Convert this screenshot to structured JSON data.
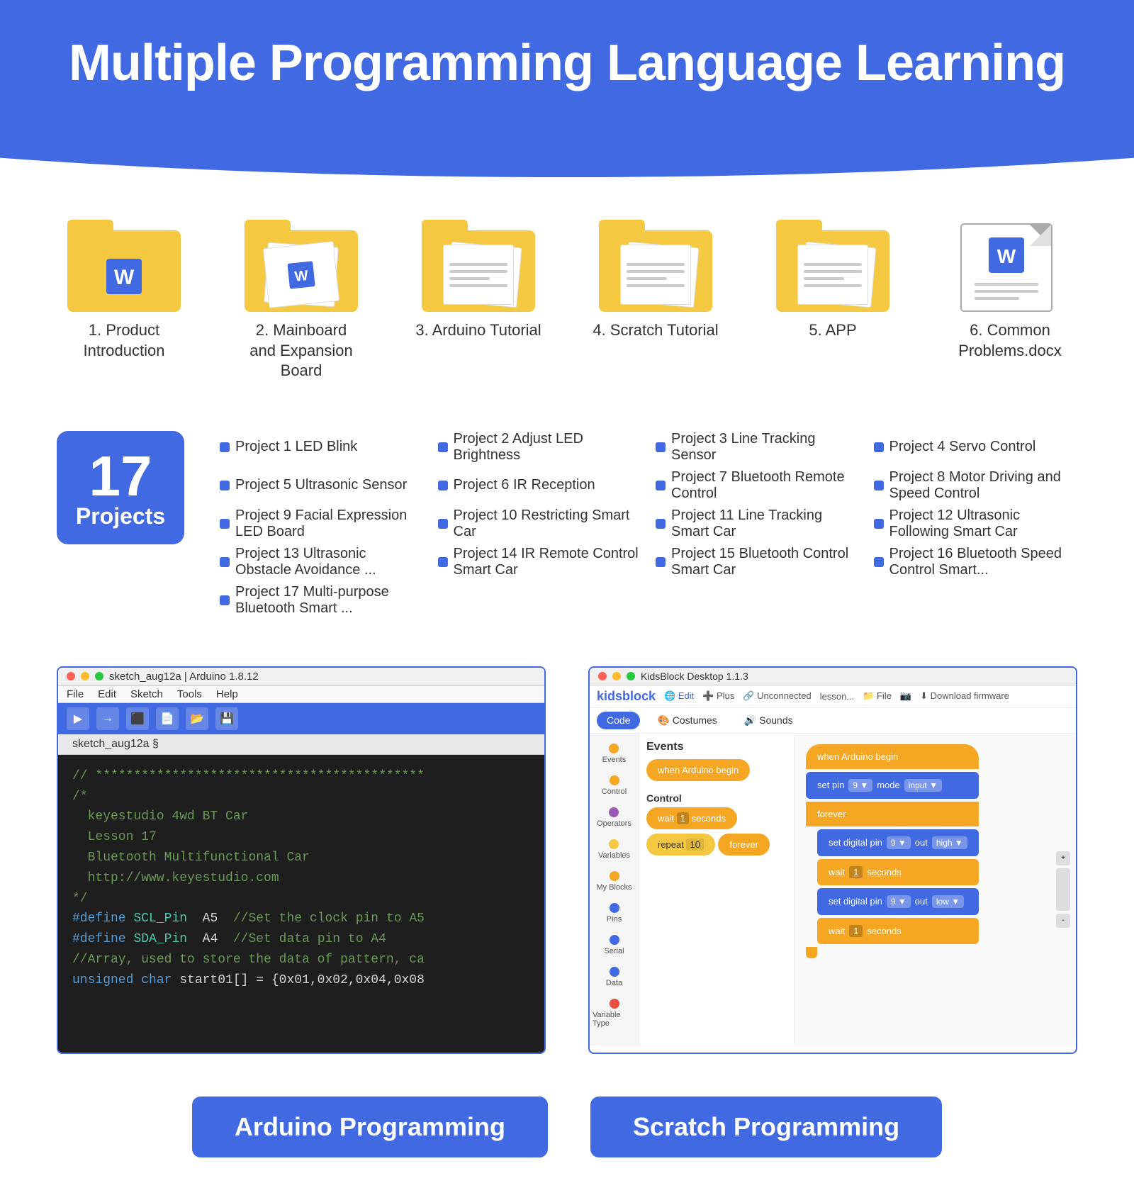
{
  "header": {
    "title": "Multiple Programming Language Learning"
  },
  "folders": [
    {
      "id": "folder-1",
      "label": "1. Product Introduction",
      "type": "folder-plain"
    },
    {
      "id": "folder-2",
      "label": "2. Mainboard and Expansion Board",
      "type": "folder-papers"
    },
    {
      "id": "folder-3",
      "label": "3. Arduino Tutorial",
      "type": "folder-lines"
    },
    {
      "id": "folder-4",
      "label": "4. Scratch Tutorial",
      "type": "folder-lines"
    },
    {
      "id": "folder-5",
      "label": "5. APP",
      "type": "folder-lines"
    },
    {
      "id": "folder-6",
      "label": "6. Common Problems.docx",
      "type": "doc"
    }
  ],
  "projects_badge": {
    "number": "17",
    "label": "Projects"
  },
  "projects": [
    "Project 1 LED Blink",
    "Project 2 Adjust LED Brightness",
    "Project 3 Line Tracking Sensor",
    "Project 4 Servo Control",
    "Project 5 Ultrasonic Sensor",
    "Project 6 IR Reception",
    "Project 7 Bluetooth Remote Control",
    "Project 8 Motor Driving and Speed Control",
    "Project 9 Facial Expression LED Board",
    "Project 10 Restricting Smart Car",
    "Project 11 Line Tracking Smart Car",
    "Project 12 Ultrasonic Following Smart Car",
    "Project 13 Ultrasonic Obstacle Avoidance ...",
    "Project 14 IR Remote Control Smart Car",
    "Project 15 Bluetooth Control Smart Car",
    "Project 16 Bluetooth Speed Control Smart...",
    "Project 17 Multi-purpose Bluetooth Smart ..."
  ],
  "arduino_window": {
    "titlebar": "sketch_aug12a | Arduino 1.8.12",
    "menubar": [
      "File",
      "Edit",
      "Sketch",
      "Tools",
      "Help"
    ],
    "tab": "sketch_aug12a §",
    "code_lines": [
      "// *******************************************",
      "/*",
      "  keyestudio 4wd BT Car",
      "  Lesson 17",
      "  Bluetooth Multifunctional Car",
      "  http://www.keyestudio.com",
      "*/",
      "#define SCL_Pin  A5  //Set the clock pin to A5",
      "#define SDA_Pin  A4  //Set data pin to A4",
      "//Array, used to store the data of pattern, ca",
      "unsigned char start01[] = {0x01,0x02,0x04,0x08"
    ]
  },
  "kidsblock_window": {
    "titlebar": "KidsBlock Desktop 1.1.3",
    "nav_brand": "kidsblock",
    "nav_items": [
      "Edit",
      "Plus",
      "Unconnected",
      "lesson...",
      "File",
      "",
      "Download firmware"
    ],
    "tabs": [
      "Code",
      "Costumes",
      "Sounds"
    ],
    "sidebar_items": [
      "Events",
      "Control",
      "Operators",
      "Variables",
      "My Blocks",
      "Pins",
      "Serial",
      "Data",
      "Variable Type"
    ],
    "sidebar_colors": [
      "#f5a623",
      "#f5a623",
      "#9b59b6",
      "#f5c842",
      "#f5a623",
      "#4169e1",
      "#4169e1",
      "#4169e1",
      "#e74c3c"
    ],
    "blocks_panel_title": "Events",
    "blocks": [
      "when Arduino begin"
    ],
    "control_title": "Control",
    "control_blocks": [
      "wait 1 seconds",
      "repeat 10",
      "forever"
    ],
    "canvas_blocks": [
      "when Arduino begin",
      "set pin 9 ▼ mode input ▼",
      "forever",
      "set digital pin 9 ▼ out high ▼",
      "wait 1 seconds",
      "set digital pin 9 ▼ out low ▼",
      "wait 1 seconds"
    ]
  },
  "labels": {
    "arduino": "Arduino Programming",
    "scratch": "Scratch Programming"
  }
}
